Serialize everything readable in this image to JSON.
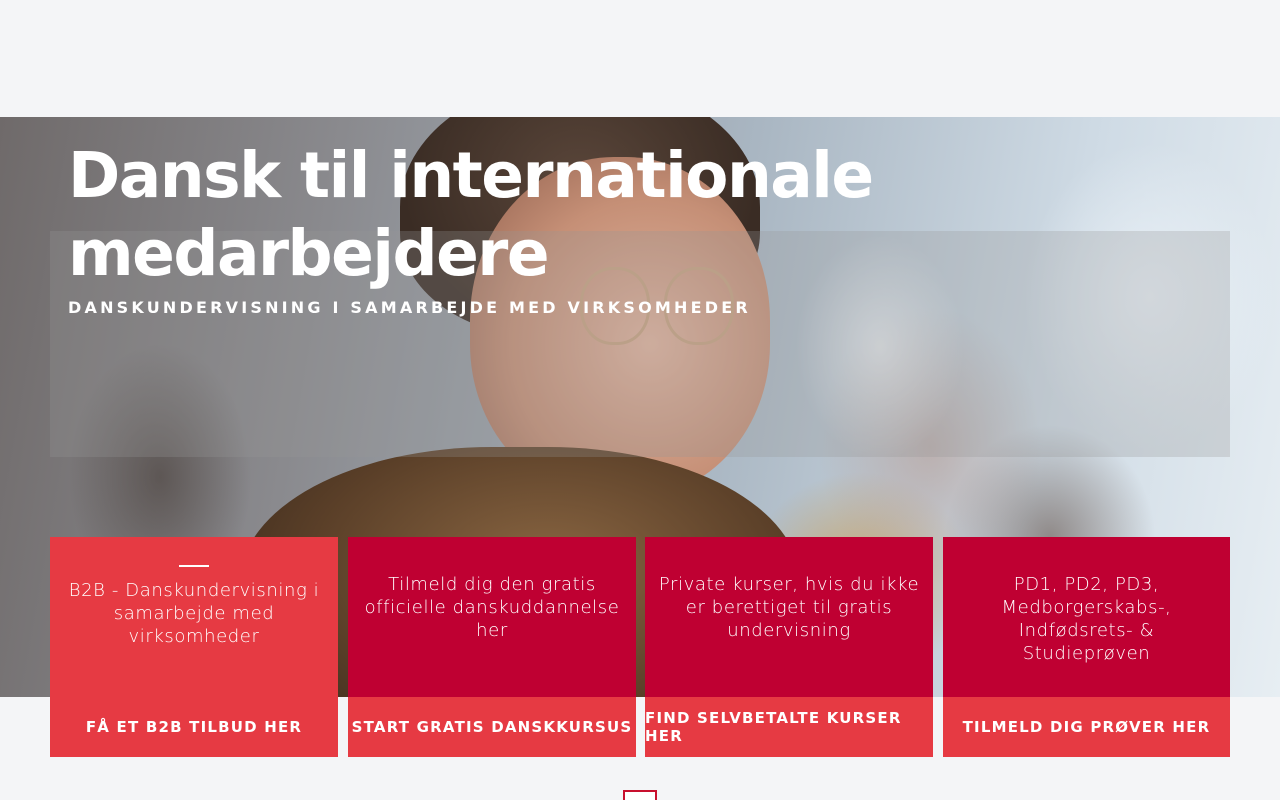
{
  "hero": {
    "title": "Dansk til internationale medarbejdere",
    "subtitle": "DANSKUNDERVISNING I SAMARBEJDE MED VIRKSOMHEDER"
  },
  "cards": [
    {
      "text": "B2B - Danskundervisning i samarbejde med virksomheder",
      "cta": "FÅ ET B2B TILBUD HER",
      "color": "#e63a43"
    },
    {
      "text": "Tilmeld dig den gratis officielle danskuddannelse her",
      "cta": "START GRATIS DANSKKURSUS",
      "color": "#bf0032"
    },
    {
      "text": "Private kurser, hvis du ikke er berettiget til gratis undervisning",
      "cta": "FIND SELVBETALTE KURSER HER",
      "color": "#bf0032"
    },
    {
      "text": "PD1, PD2, PD3, Medborgerskabs-, Indfødsrets- & Studieprøven",
      "cta": "TILMELD DIG PRØVER HER",
      "color": "#bf0032"
    }
  ],
  "colors": {
    "accent_red": "#e63a43",
    "deep_red": "#bf0032",
    "page_bg": "#f4f5f7"
  }
}
